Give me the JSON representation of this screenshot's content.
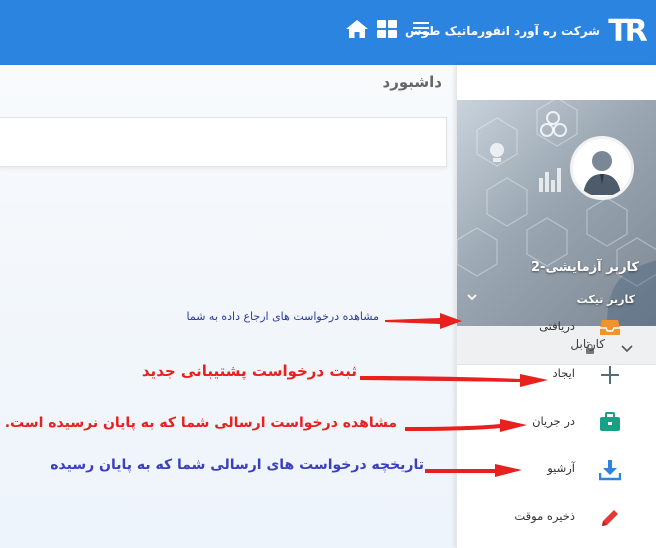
{
  "header": {
    "company_name": "شرکت ره آورد انفورماتیک طوس",
    "logo_text": "TR",
    "brand_color": "#2b84e0"
  },
  "page": {
    "title": "داشبورد"
  },
  "profile": {
    "user_name": "کاربر آزمایشی-2",
    "user_role": "کاربر تیکت"
  },
  "sidebar": {
    "section_label": "کارتابل",
    "items": [
      {
        "label": "دریافتی",
        "icon": "inbox-icon",
        "color": "#f0932b"
      },
      {
        "label": "ایجاد",
        "icon": "plus-icon",
        "color": "#546e7a"
      },
      {
        "label": "در جریان",
        "icon": "briefcase-icon",
        "color": "#16a085"
      },
      {
        "label": "آرشیو",
        "icon": "download-icon",
        "color": "#2b84e0"
      },
      {
        "label": "ذخیره موقت",
        "icon": "pencil-icon",
        "color": "#e53935"
      }
    ]
  },
  "annotations": {
    "received": "مشاهده درخواست های ارجاع داده به شما",
    "create": "ثبت درخواست  پشتیبانی جدید",
    "in_progress": "مشاهده درخواست ارسالی شما که به پایان نرسیده است.",
    "archive": "تاریخچه درخواست های   ارسالی شما که به پایان رسیده"
  }
}
